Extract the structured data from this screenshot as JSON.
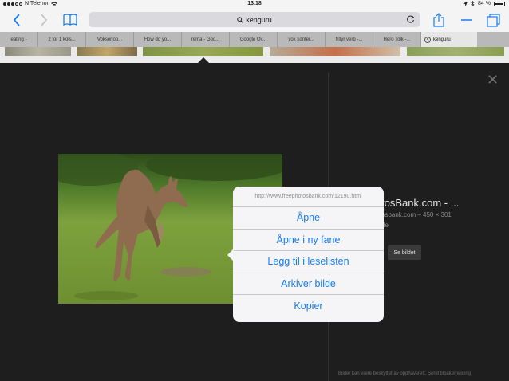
{
  "status": {
    "carrier": "N Telenor",
    "time": "13.18",
    "battery": "84 %"
  },
  "toolbar": {
    "url_text": "kenguru"
  },
  "tabs": [
    {
      "label": "eating -"
    },
    {
      "label": "2 for 1 kols..."
    },
    {
      "label": "Voksenop..."
    },
    {
      "label": "How do yo..."
    },
    {
      "label": "rema - Goo..."
    },
    {
      "label": "Google Ov..."
    },
    {
      "label": "vox konfer..."
    },
    {
      "label": "frityr verb -..."
    },
    {
      "label": "Hero Tolk -..."
    },
    {
      "label": "kenguru",
      "active": true
    }
  ],
  "side_panel": {
    "title": "tosBank.com - ...",
    "source": "osbank.com – 450 × 301",
    "size": "de",
    "see_button": "Se bildet",
    "footnote": "Bilder kan være beskyttet av opphavsrett.   Send tilbakemelding"
  },
  "popover": {
    "url": "http://www.freephotosbank.com/12190.html",
    "items": [
      {
        "label": "Åpne"
      },
      {
        "label": "Åpne i ny fane"
      },
      {
        "label": "Legg til i leselisten"
      },
      {
        "label": "Arkiver bilde"
      },
      {
        "label": "Kopier"
      }
    ]
  },
  "colors": {
    "accent": "#1a7cf0",
    "background": "#1e1e1e"
  }
}
